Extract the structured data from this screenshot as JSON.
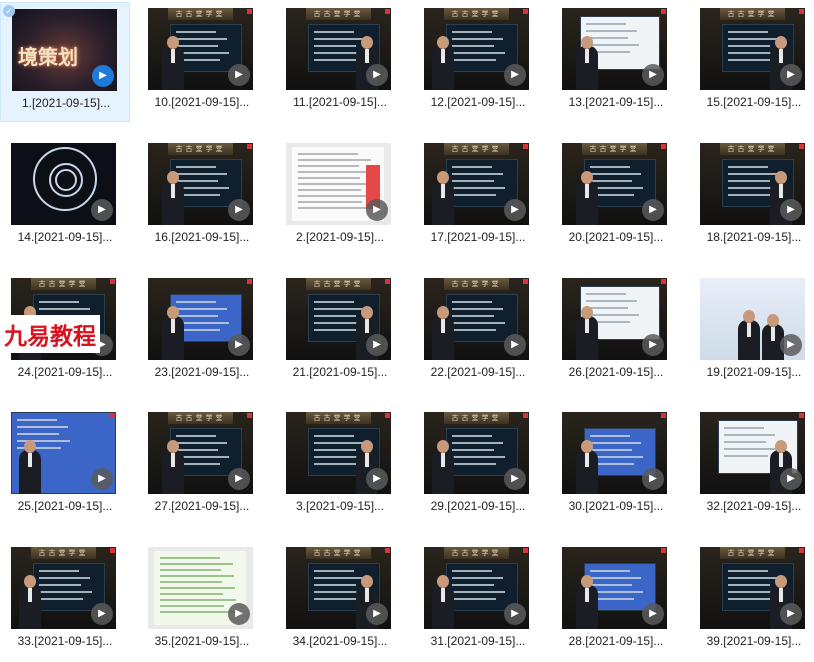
{
  "watermark": "九易教程",
  "items": [
    {
      "label": "1.[2021-09-15]...",
      "kind": "cover",
      "selected": true,
      "caption": "境策划"
    },
    {
      "label": "10.[2021-09-15]...",
      "kind": "lecture-dark"
    },
    {
      "label": "11.[2021-09-15]...",
      "kind": "screen-text"
    },
    {
      "label": "12.[2021-09-15]...",
      "kind": "screen-diagram"
    },
    {
      "label": "13.[2021-09-15]...",
      "kind": "screen-light"
    },
    {
      "label": "15.[2021-09-15]...",
      "kind": "lecture-dark"
    },
    {
      "label": "14.[2021-09-15]...",
      "kind": "circle"
    },
    {
      "label": "16.[2021-09-15]...",
      "kind": "lecture-banner"
    },
    {
      "label": "2.[2021-09-15]...",
      "kind": "document"
    },
    {
      "label": "17.[2021-09-15]...",
      "kind": "lecture-banner"
    },
    {
      "label": "20.[2021-09-15]...",
      "kind": "screen-diagram"
    },
    {
      "label": "18.[2021-09-15]...",
      "kind": "lecture-banner"
    },
    {
      "label": "24.[2021-09-15]...",
      "kind": "screen-text"
    },
    {
      "label": "23.[2021-09-15]...",
      "kind": "screen-blue"
    },
    {
      "label": "21.[2021-09-15]...",
      "kind": "screen-text"
    },
    {
      "label": "22.[2021-09-15]...",
      "kind": "lecture-dark"
    },
    {
      "label": "26.[2021-09-15]...",
      "kind": "screen-light"
    },
    {
      "label": "19.[2021-09-15]...",
      "kind": "presenter"
    },
    {
      "label": "25.[2021-09-15]...",
      "kind": "screen-blue-full"
    },
    {
      "label": "27.[2021-09-15]...",
      "kind": "lecture-banner"
    },
    {
      "label": "3.[2021-09-15]...",
      "kind": "lecture-dark"
    },
    {
      "label": "29.[2021-09-15]...",
      "kind": "lecture-banner"
    },
    {
      "label": "30.[2021-09-15]...",
      "kind": "screen-blue"
    },
    {
      "label": "32.[2021-09-15]...",
      "kind": "screen-light"
    },
    {
      "label": "33.[2021-09-15]...",
      "kind": "lecture-banner"
    },
    {
      "label": "35.[2021-09-15]...",
      "kind": "document-green"
    },
    {
      "label": "34.[2021-09-15]...",
      "kind": "lecture-banner"
    },
    {
      "label": "31.[2021-09-15]...",
      "kind": "lecture-banner"
    },
    {
      "label": "28.[2021-09-15]...",
      "kind": "screen-blue"
    },
    {
      "label": "39.[2021-09-15]...",
      "kind": "lecture-banner"
    }
  ],
  "banner_text": "古古堂学堂",
  "icons": {
    "play": "play-icon",
    "check": "check-icon"
  }
}
